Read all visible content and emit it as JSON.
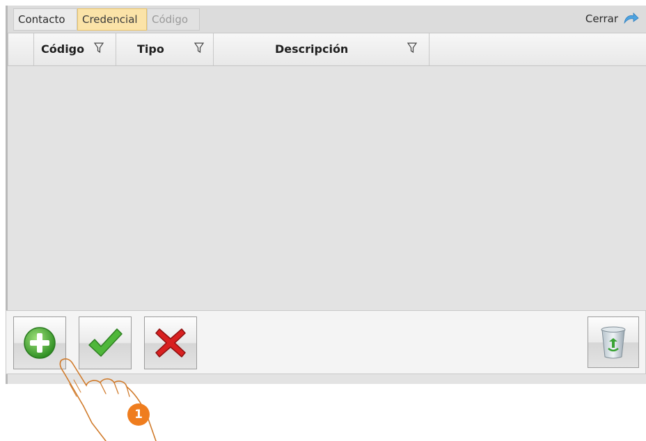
{
  "tabs": [
    {
      "label": "Contacto"
    },
    {
      "label": "Credencial"
    },
    {
      "label": "Código"
    }
  ],
  "close": {
    "label": "Cerrar",
    "icon": "close-arrow-icon"
  },
  "grid": {
    "columns": [
      {
        "label": "Código"
      },
      {
        "label": "Tipo"
      },
      {
        "label": "Descripción"
      }
    ]
  },
  "toolbar": {
    "add_icon": "add-icon",
    "confirm_icon": "checkmark-icon",
    "cancel_icon": "cancel-x-icon",
    "delete_icon": "trash-icon"
  },
  "annotation": {
    "step": "1"
  },
  "colors": {
    "active_tab": "#fbe3a8",
    "badge": "#ef7d1e"
  }
}
